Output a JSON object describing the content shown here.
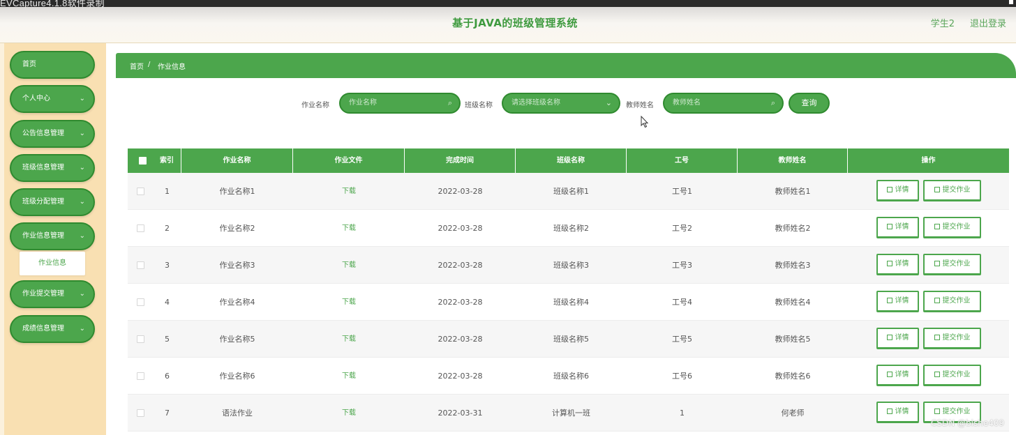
{
  "capture": {
    "title": "EVCapture4.1.8软件录制"
  },
  "header": {
    "title": "基于JAVA的班级管理系统",
    "user": "学生2",
    "logout": "退出登录"
  },
  "sidebar": {
    "items": [
      {
        "label": "首页",
        "has_arrow": false
      },
      {
        "label": "个人中心",
        "has_arrow": true
      },
      {
        "label": "公告信息管理",
        "has_arrow": true
      },
      {
        "label": "班级信息管理",
        "has_arrow": true
      },
      {
        "label": "班级分配管理",
        "has_arrow": true
      },
      {
        "label": "作业信息管理",
        "has_arrow": true
      },
      {
        "label": "作业提交管理",
        "has_arrow": true
      },
      {
        "label": "成绩信息管理",
        "has_arrow": true
      }
    ],
    "arrow": "⌄",
    "submenu_label": "作业信息"
  },
  "breadcrumb": {
    "home": "首页",
    "separator": "/",
    "current": "作业信息"
  },
  "search": {
    "homework_name_label": "作业名称",
    "homework_name_placeholder": "作业名称",
    "class_name_label": "班级名称",
    "class_name_placeholder": "请选择班级名称",
    "teacher_name_label": "教师姓名",
    "teacher_name_placeholder": "教师姓名",
    "query_button": "查询",
    "search_icon": "⌕",
    "dropdown_icon": "⌄"
  },
  "table": {
    "columns": [
      "索引",
      "作业名称",
      "作业文件",
      "完成时间",
      "班级名称",
      "工号",
      "教师姓名",
      "操作"
    ],
    "detail_label": "详情",
    "submit_label": "提交作业",
    "rows": [
      {
        "index": "1",
        "name": "作业名称1",
        "file": "下载",
        "time": "2022-03-28",
        "class": "班级名称1",
        "job_no": "工号1",
        "teacher": "教师姓名1"
      },
      {
        "index": "2",
        "name": "作业名称2",
        "file": "下载",
        "time": "2022-03-28",
        "class": "班级名称2",
        "job_no": "工号2",
        "teacher": "教师姓名2"
      },
      {
        "index": "3",
        "name": "作业名称3",
        "file": "下载",
        "time": "2022-03-28",
        "class": "班级名称3",
        "job_no": "工号3",
        "teacher": "教师姓名3"
      },
      {
        "index": "4",
        "name": "作业名称4",
        "file": "下载",
        "time": "2022-03-28",
        "class": "班级名称4",
        "job_no": "工号4",
        "teacher": "教师姓名4"
      },
      {
        "index": "5",
        "name": "作业名称5",
        "file": "下载",
        "time": "2022-03-28",
        "class": "班级名称5",
        "job_no": "工号5",
        "teacher": "教师姓名5"
      },
      {
        "index": "6",
        "name": "作业名称6",
        "file": "下载",
        "time": "2022-03-28",
        "class": "班级名称6",
        "job_no": "工号6",
        "teacher": "教师姓名6"
      },
      {
        "index": "7",
        "name": "语法作业",
        "file": "下载",
        "time": "2022-03-31",
        "class": "计算机一班",
        "job_no": "1",
        "teacher": "何老师"
      }
    ]
  },
  "watermark": "CSDN @bishe409",
  "colors": {
    "primary": "#4ca64c",
    "primary_dark": "#2f8a2f",
    "sidebar_bg": "#f9e0b2"
  }
}
